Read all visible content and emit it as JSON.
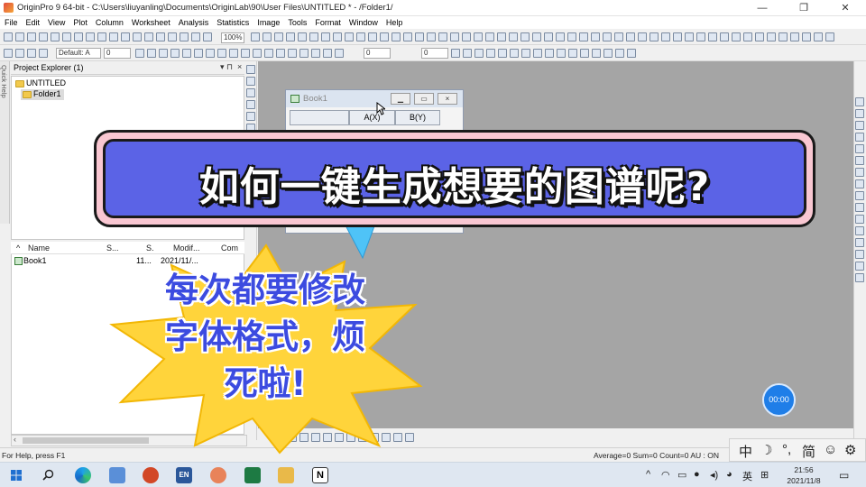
{
  "window": {
    "title": "OriginPro 9 64-bit - C:\\Users\\liuyanling\\Documents\\OriginLab\\90\\User Files\\UNTITLED * - /Folder1/",
    "controls": [
      "—",
      "❐",
      "✕"
    ]
  },
  "menu": [
    "File",
    "Edit",
    "View",
    "Plot",
    "Column",
    "Worksheet",
    "Analysis",
    "Statistics",
    "Image",
    "Tools",
    "Format",
    "Window",
    "Help"
  ],
  "toolbar": {
    "zoom": "100%",
    "font": "Default: A",
    "font_size": "0",
    "line_width": "0",
    "fill_value": "0"
  },
  "quick_help": "Quick Help",
  "project_explorer": {
    "title": "Project Explorer (1)",
    "tree": {
      "root": "UNTITLED",
      "folder": "Folder1"
    },
    "columns": [
      "Name",
      "S...",
      "S.",
      "Modif...",
      "Com"
    ],
    "rows": [
      {
        "name": "Book1",
        "size": "11...",
        "modified": "2021/11/..."
      }
    ]
  },
  "book": {
    "title": "Book1",
    "columns": [
      "A(X)",
      "B(Y)"
    ]
  },
  "status": {
    "left": "For Help, press F1",
    "right": "Average=0 Sum=0 Count=0 AU : ON"
  },
  "ime": [
    "中",
    "☽",
    "°,",
    "简",
    "☺",
    "⚙"
  ],
  "timer": "00:00",
  "taskbar": {
    "time": "21:56",
    "date": "2021/11/8",
    "lang": "英"
  },
  "overlay": {
    "banner": "如何一键生成想要的图谱呢?",
    "burst_lines": [
      "每次都要修改",
      "字体格式，烦",
      "死啦!"
    ]
  },
  "colors": {
    "banner_fill": "#5b63e6",
    "banner_border": "#f9c7d2",
    "burst_fill": "#ffd43b",
    "burst_text": "#3c4be0",
    "workspace": "#a5a5a5"
  }
}
